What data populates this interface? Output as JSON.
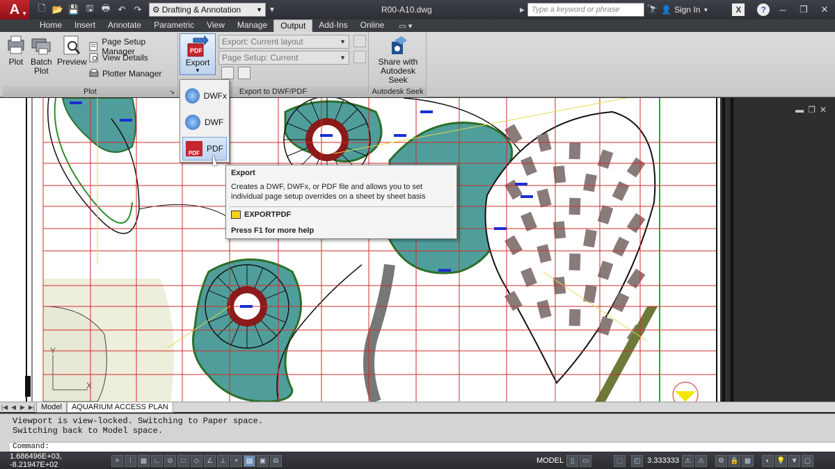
{
  "title_bar": {
    "workspace": "Drafting & Annotation",
    "document": "R00-A10.dwg",
    "search_placeholder": "Type a keyword or phrase",
    "sign_in": "Sign In"
  },
  "ribbon_tabs": [
    "Home",
    "Insert",
    "Annotate",
    "Parametric",
    "View",
    "Manage",
    "Output",
    "Add-Ins",
    "Online"
  ],
  "active_tab": "Output",
  "plot_panel": {
    "title": "Plot",
    "plot": "Plot",
    "batch_plot_1": "Batch",
    "batch_plot_2": "Plot",
    "preview": "Preview",
    "page_setup_manager": "Page Setup Manager",
    "view_details": "View Details",
    "plotter_manager": "Plotter Manager"
  },
  "export_panel": {
    "title": "Export to DWF/PDF",
    "export_button": "Export",
    "export_combo": "Export: Current layout",
    "page_setup_combo": "Page Setup: Current"
  },
  "seek_panel": {
    "title": "Autodesk Seek",
    "share_1": "Share with",
    "share_2": "Autodesk Seek"
  },
  "export_menu": [
    "DWFx",
    "DWF",
    "PDF"
  ],
  "tooltip": {
    "title": "Export",
    "description": "Creates a DWF, DWFx, or PDF file and allows you to set individual page setup overrides on a sheet by sheet basis",
    "command": "EXPORTPDF",
    "help": "Press F1 for more help"
  },
  "layout_tabs": [
    "Model",
    "AQUARIUM ACCESS PLAN"
  ],
  "active_layout": "AQUARIUM ACCESS PLAN",
  "command_history": [
    "Viewport is view-locked. Switching to Paper space.",
    "Switching back to Model space."
  ],
  "command_prompt": "Command:",
  "status": {
    "coordinates": "1.686496E+03, -8.21947E+02",
    "model": "MODEL",
    "scale": "3.333333"
  },
  "colors": {
    "brand": "#c4262e",
    "grid": "#d12a2a",
    "water": "#4f9e9c",
    "highlight": "#bcd4f0"
  }
}
